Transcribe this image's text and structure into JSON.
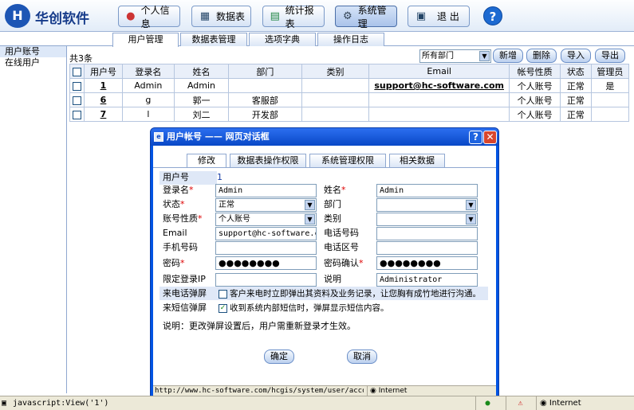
{
  "header": {
    "logo_glyph": "H",
    "brand": "华创软件",
    "buttons": [
      {
        "label": "个人信息",
        "icon": "person-icon"
      },
      {
        "label": "数据表",
        "icon": "table-icon"
      },
      {
        "label": "统计报表",
        "icon": "report-icon"
      },
      {
        "label": "系统管理",
        "icon": "gear-icon"
      },
      {
        "label": "退 出",
        "icon": "exit-icon"
      }
    ],
    "help": "?"
  },
  "tabs": [
    "用户管理",
    "数据表管理",
    "选项字典",
    "操作日志"
  ],
  "sidebar": [
    "用户账号",
    "在线用户"
  ],
  "toolbar": {
    "count": "共3条",
    "department": "所有部门",
    "add": "新增",
    "delete": "删除",
    "import": "导入",
    "export": "导出"
  },
  "table": {
    "headers": [
      "用户号",
      "登录名",
      "姓名",
      "部门",
      "类别",
      "Email",
      "帐号性质",
      "状态",
      "管理员"
    ],
    "rows": [
      {
        "id": "1",
        "login": "Admin",
        "name": "Admin",
        "dept": "",
        "category": "",
        "email": "support@hc-software.com",
        "type": "个人账号",
        "status": "正常",
        "admin": "是"
      },
      {
        "id": "6",
        "login": "g",
        "name": "郭一",
        "dept": "客服部",
        "category": "",
        "email": "",
        "type": "个人账号",
        "status": "正常",
        "admin": ""
      },
      {
        "id": "7",
        "login": "l",
        "name": "刘二",
        "dept": "开发部",
        "category": "",
        "email": "",
        "type": "个人账号",
        "status": "正常",
        "admin": ""
      }
    ]
  },
  "dialog": {
    "title": "用户帐号 —— 网页对话框",
    "tabs": [
      "修改",
      "数据表操作权限",
      "系统管理权限",
      "相关数据"
    ],
    "fields": {
      "user_id_label": "用户号",
      "user_id": "1",
      "login_label": "登录名",
      "login": "Admin",
      "name_label": "姓名",
      "name": "Admin",
      "status_label": "状态",
      "status": "正常",
      "dept_label": "部门",
      "dept": "",
      "acct_type_label": "账号性质",
      "acct_type": "个人账号",
      "category_label": "类别",
      "category": "",
      "email_label": "Email",
      "email": "support@hc-software.com",
      "phone_label": "电话号码",
      "phone": "",
      "mobile_label": "手机号码",
      "mobile": "",
      "area_code_label": "电话区号",
      "area_code": "",
      "password_label": "密码",
      "password": "●●●●●●●●",
      "confirm_label": "密码确认",
      "confirm": "●●●●●●●●",
      "ip_label": "限定登录IP",
      "ip": "",
      "note_label": "说明",
      "note": "Administrator",
      "call_popup_label": "来电话弹屏",
      "call_popup_text": "客户来电时立即弹出其资料及业务记录，让您胸有成竹地进行沟通。",
      "call_popup_checked": false,
      "sms_popup_label": "来短信弹屏",
      "sms_popup_text": "收到系统内部短信时，弹屏显示短信内容。",
      "sms_popup_checked": true,
      "notice": "说明：更改弹屏设置后，用户需重新登录才生效。"
    },
    "ok": "确定",
    "cancel": "取消",
    "status_url": "http://www.hc-software.com/hcgis/system/user/account/fr",
    "status_zone": "Internet"
  },
  "statusbar": {
    "text": "javascript:View('1')",
    "zone": "Internet"
  }
}
